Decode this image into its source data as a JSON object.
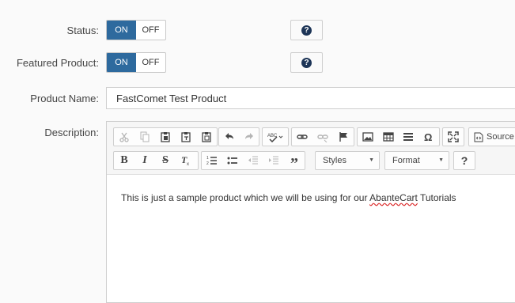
{
  "status": {
    "label": "Status:",
    "on": "ON",
    "off": "OFF"
  },
  "featured": {
    "label": "Featured Product:",
    "on": "ON",
    "off": "OFF"
  },
  "help_glyph": "?",
  "product_name": {
    "label": "Product Name:",
    "value": "FastComet Test Product"
  },
  "description": {
    "label": "Description:",
    "toolbar": {
      "source_label": "Source",
      "styles_label": "Styles",
      "format_label": "Format",
      "help_glyph": "?"
    },
    "content_prefix": "This is just a sample product which we will be using for our ",
    "content_misspelled": "AbanteCart",
    "content_suffix": " Tutorials"
  },
  "colors": {
    "accent": "#2e6a9e",
    "help_icon": "#1d3557"
  }
}
